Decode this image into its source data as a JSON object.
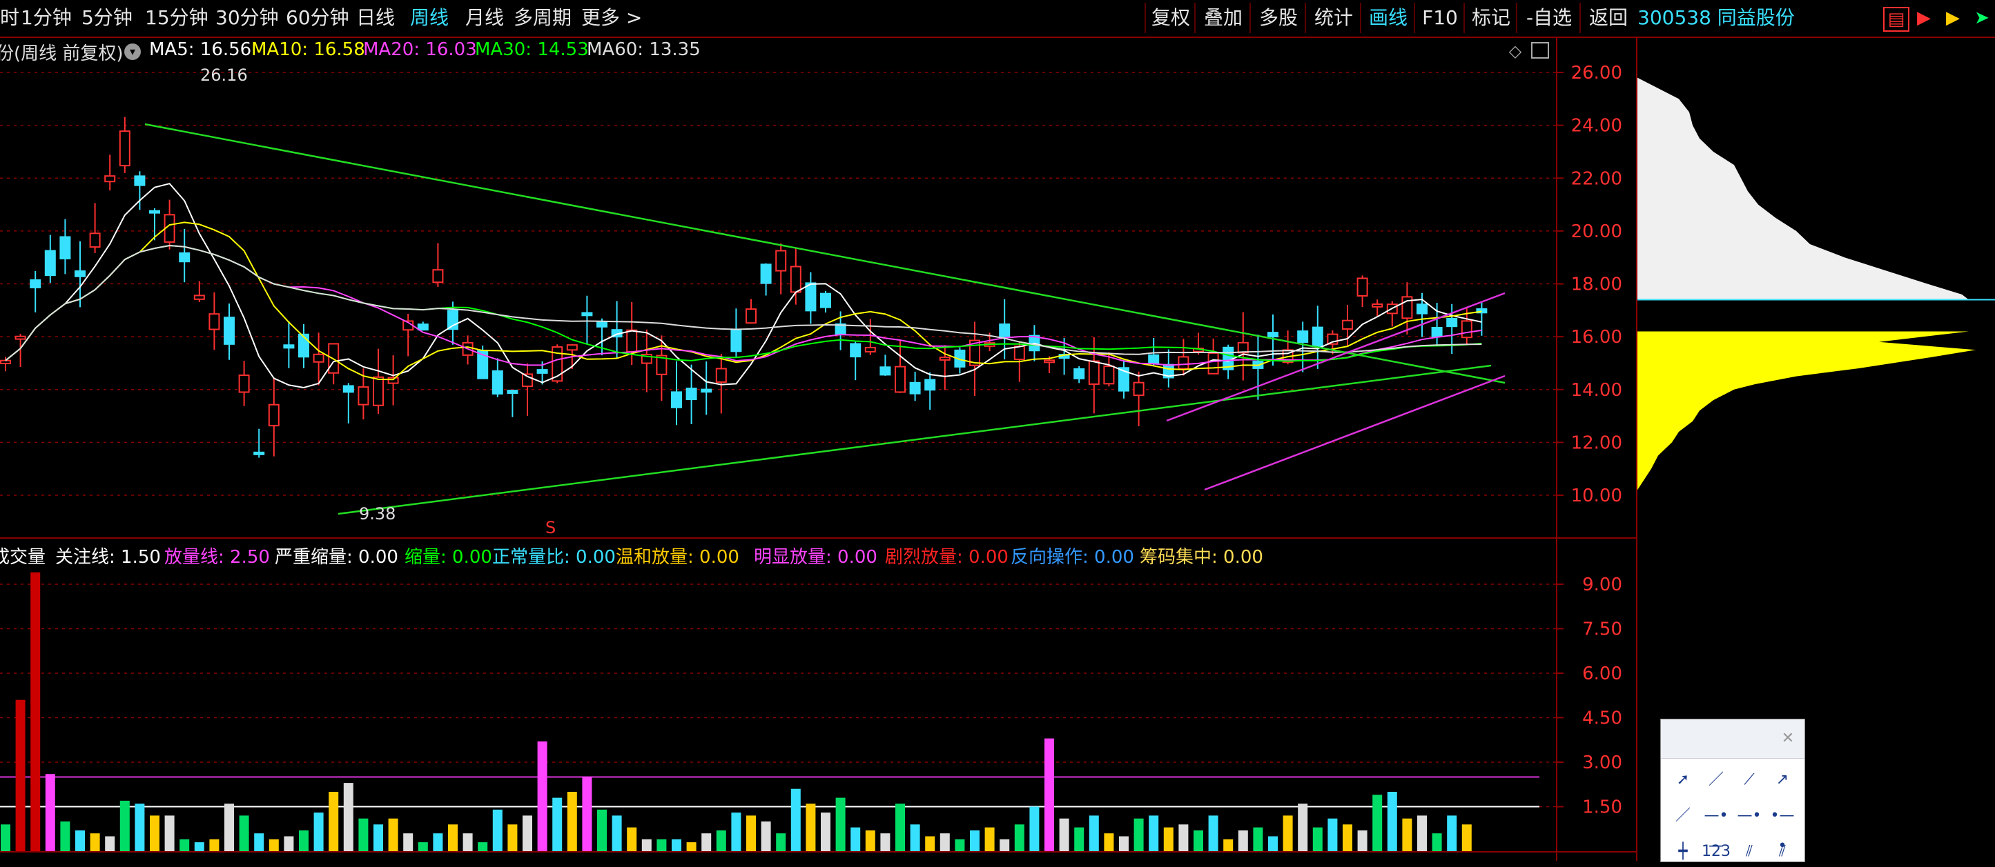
{
  "toolbar": {
    "left_items": [
      "时",
      "1分钟",
      "5分钟",
      "15分钟",
      "30分钟",
      "60分钟",
      "日线",
      "周线",
      "月线",
      "多周期",
      "更多 >"
    ],
    "active_left": "周线",
    "right_items": [
      "复权",
      "叠加",
      "多股",
      "统计",
      "画线",
      "F10",
      "标记",
      "-自选",
      "返回"
    ],
    "active_right": "画线",
    "stock_label": "300538 同益股份"
  },
  "main_info": {
    "label": "份(周线 前复权)",
    "ma": [
      {
        "name": "MA5: 16.56",
        "color": "#ffffff"
      },
      {
        "name": "MA10: 16.58",
        "color": "#ffff00"
      },
      {
        "name": "MA20: 16.03",
        "color": "#ff44ff"
      },
      {
        "name": "MA30: 14.53",
        "color": "#00ff00"
      },
      {
        "name": "MA60: 13.35",
        "color": "#dddddd"
      }
    ]
  },
  "price_axis": [
    "26.00",
    "24.00",
    "22.00",
    "20.00",
    "18.00",
    "16.00",
    "14.00",
    "12.00",
    "10.00"
  ],
  "annotations": {
    "high": "26.16",
    "low": "9.38",
    "signal": "S"
  },
  "volume_info": [
    {
      "text": "成交量",
      "color": "#ffffff"
    },
    {
      "text": "关注线: 1.50",
      "color": "#ffffff"
    },
    {
      "text": "放量线: 2.50",
      "color": "#ff44ff"
    },
    {
      "text": "严重缩量: 0.00",
      "color": "#ffffff"
    },
    {
      "text": "缩量: 0.00",
      "color": "#00ff00"
    },
    {
      "text": "正常量比: 0.00",
      "color": "#38e0ff"
    },
    {
      "text": "温和放量: 0.00",
      "color": "#ffcc00"
    },
    {
      "text": "明显放量: 0.00",
      "color": "#ff44ff"
    },
    {
      "text": "剧烈放量: 0.00",
      "color": "#ff2222"
    },
    {
      "text": "反向操作: 0.00",
      "color": "#3399ff"
    },
    {
      "text": "筹码集中: 0.00",
      "color": "#ffdd55"
    }
  ],
  "volume_axis": [
    "9.00",
    "7.50",
    "6.00",
    "4.50",
    "3.00",
    "1.50"
  ],
  "drawing_tools": [
    "cursor",
    "line",
    "ray",
    "arrow",
    "segment",
    "horizontal",
    "h-ray",
    "h-segment",
    "vertical",
    "text-123",
    "parallel",
    "channel"
  ],
  "colors": {
    "up": "#ff3030",
    "down": "#38e0ff",
    "grid": "#8b0000",
    "axis_text": "#ff3030"
  }
}
